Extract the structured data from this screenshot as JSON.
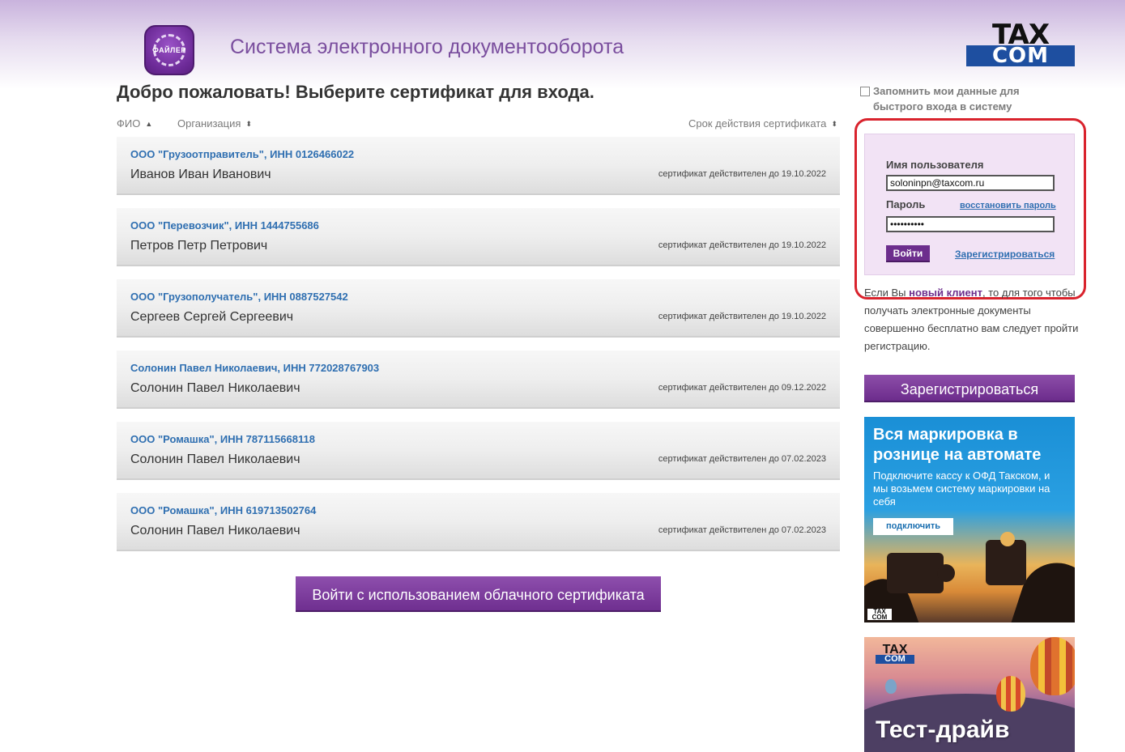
{
  "header": {
    "logo_text": "ФАЙЛЕР",
    "system_title": "Система электронного документооборота",
    "taxcom_top": "TAX",
    "taxcom_bottom": "COM"
  },
  "welcome": "Добро пожаловать! Выберите сертификат для входа.",
  "columns": {
    "fio": "ФИО",
    "organization": "Организация",
    "expiry": "Срок действия сертификата"
  },
  "certificates": [
    {
      "org": "ООО \"Грузоотправитель\"",
      "inn": ", ИНН 0126466022",
      "fio": "Иванов Иван Иванович",
      "valid": "сертификат действителен до 19.10.2022"
    },
    {
      "org": "ООО \"Перевозчик\"",
      "inn": ", ИНН 1444755686",
      "fio": "Петров Петр Петрович",
      "valid": "сертификат действителен до 19.10.2022"
    },
    {
      "org": "ООО \"Грузополучатель\"",
      "inn": ", ИНН 0887527542",
      "fio": "Сергеев Сергей Сергеевич",
      "valid": "сертификат действителен до 19.10.2022"
    },
    {
      "org": "Солонин Павел Николаевич",
      "inn": ", ИНН 772028767903",
      "fio": "Солонин Павел Николаевич",
      "valid": "сертификат действителен до 09.12.2022"
    },
    {
      "org": "ООО \"Ромашка\"",
      "inn": ", ИНН 787115668118",
      "fio": "Солонин Павел Николаевич",
      "valid": "сертификат действителен до 07.02.2023"
    },
    {
      "org": "ООО \"Ромашка\"",
      "inn": ", ИНН 619713502764",
      "fio": "Солонин Павел Николаевич",
      "valid": "сертификат действителен до 07.02.2023"
    }
  ],
  "cloud_button": "Войти с использованием облачного сертификата",
  "sidebar": {
    "remember": "Запомнить мои данные для быстрого входа в систему",
    "login": {
      "username_label": "Имя пользователя",
      "username_value": "soloninpn@taxcom.ru",
      "password_label": "Пароль",
      "password_value": "••••••••••",
      "restore_link": "восстановить пароль",
      "login_button": "Войти",
      "register_link": "Зарегистрироваться"
    },
    "new_client": {
      "before": "Если Вы ",
      "bold": "новый клиент",
      "after": ", то для того чтобы получать электронные документы совершенно бесплатно вам следует пройти регистрацию."
    },
    "register_button": "Зарегистрироваться",
    "banner1": {
      "title": "Вся маркировка в рознице на автомате",
      "text": "Подключите кассу к ОФД Такском, и мы возьмем систему маркировки на себя",
      "button": "подключить",
      "logo": "TAX COM"
    },
    "banner2": {
      "logo_top": "TAX",
      "logo_bottom": "COM",
      "title": "Тест-драйв"
    }
  }
}
